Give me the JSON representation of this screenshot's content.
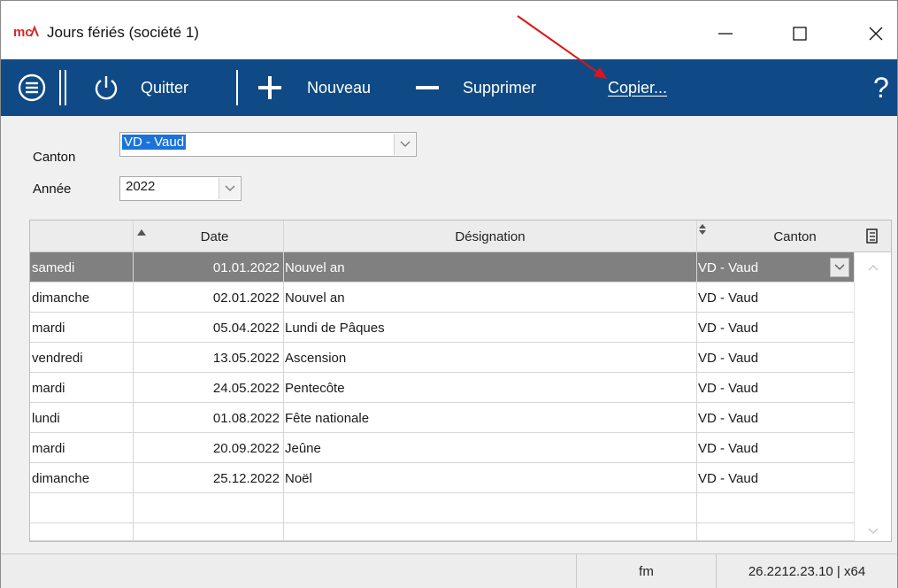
{
  "window": {
    "title": "Jours fériés (société 1)",
    "logo_text": "mc",
    "accent": "#0f4a86",
    "logo_color": "#d12a2a"
  },
  "toolbar": {
    "quit_label": "Quitter",
    "new_label": "Nouveau",
    "delete_label": "Supprimer",
    "copy_label": "Copier...",
    "help_label": "?"
  },
  "form": {
    "canton_label": "Canton",
    "canton_value": "VD - Vaud",
    "year_label": "Année",
    "year_value": "2022"
  },
  "table": {
    "headers": {
      "day": "",
      "date": "Date",
      "designation": "Désignation",
      "canton": "Canton"
    },
    "rows": [
      {
        "day": "samedi",
        "date": "01.01.2022",
        "designation": "Nouvel an",
        "canton": "VD - Vaud",
        "selected": true
      },
      {
        "day": "dimanche",
        "date": "02.01.2022",
        "designation": "Nouvel an",
        "canton": "VD - Vaud"
      },
      {
        "day": "mardi",
        "date": "05.04.2022",
        "designation": "Lundi de Pâques",
        "canton": "VD - Vaud"
      },
      {
        "day": "vendredi",
        "date": "13.05.2022",
        "designation": "Ascension",
        "canton": "VD - Vaud"
      },
      {
        "day": "mardi",
        "date": "24.05.2022",
        "designation": "Pentecôte",
        "canton": "VD - Vaud"
      },
      {
        "day": "lundi",
        "date": "01.08.2022",
        "designation": "Fête nationale",
        "canton": "VD - Vaud"
      },
      {
        "day": "mardi",
        "date": "20.09.2022",
        "designation": "Jeûne",
        "canton": "VD - Vaud"
      },
      {
        "day": "dimanche",
        "date": "25.12.2022",
        "designation": "Noël",
        "canton": "VD - Vaud"
      }
    ]
  },
  "status": {
    "user": "fm",
    "version": "26.2212.23.10 | x64"
  }
}
